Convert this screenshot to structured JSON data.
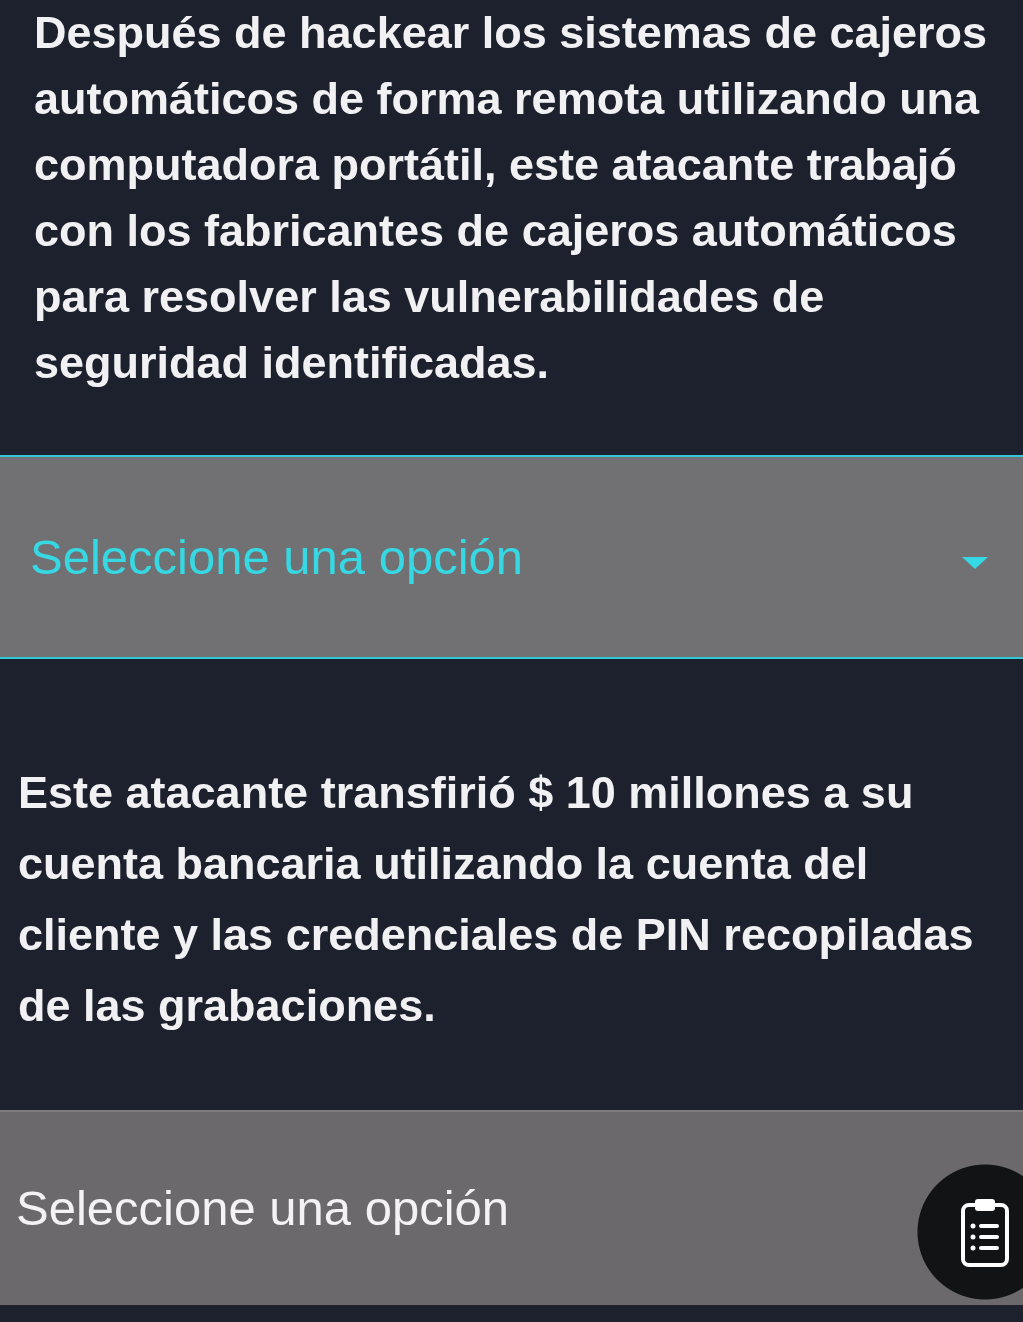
{
  "items": [
    {
      "statement": "Después de hackear los sistemas de cajeros automáticos de forma remota utilizando una computadora portátil, este atacante trabajó con los fabricantes de cajeros automáticos para resolver las vulnerabilidades de seguridad identificadas.",
      "dropdown": {
        "placeholder": "Seleccione una opción",
        "focused": true,
        "caret": true
      }
    },
    {
      "statement": "Este atacante transfirió $ 10 millones a su cuenta bancaria utilizando la cuenta del cliente y las credenciales de PIN recopiladas de las grabaciones.",
      "dropdown": {
        "placeholder": "Seleccione una opción",
        "focused": false,
        "caret": false
      }
    }
  ]
}
